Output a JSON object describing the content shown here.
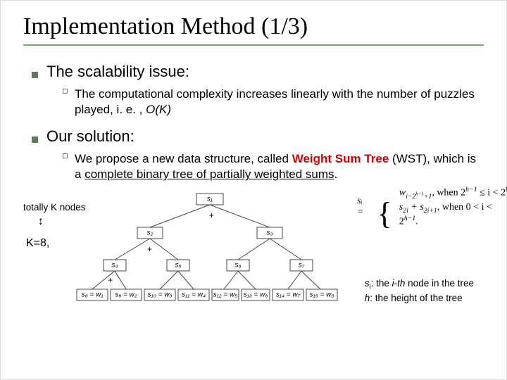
{
  "title": "Implementation Method (1/3)",
  "bullets": {
    "b1": "The scalability issue:",
    "b1_1a": "The computational complexity increases linearly with the number of puzzles played, i. e. , ",
    "b1_1b": "O(K)",
    "b2": "Our solution:",
    "b2_1a": "We propose a new data structure, called ",
    "b2_1b": "Weight Sum Tree",
    "b2_1c": " (WST), which is a ",
    "b2_1d": "complete binary tree of partially weighted sums",
    "b2_1e": "."
  },
  "figure": {
    "totally": "totally K nodes",
    "kline": "K=8,",
    "caption_l1_a": "s",
    "caption_l1_b": "i",
    "caption_l1_c": ": the ",
    "caption_l1_d": "i-th",
    "caption_l1_e": " node in the tree",
    "caption_l2_a": "h",
    "caption_l2_b": ": the height of the tree",
    "nodes": {
      "s1": "s₁",
      "s2": "s₂",
      "s3": "s₃",
      "s4": "s₄",
      "s5": "s₅",
      "s6": "s₆",
      "s7": "s₇",
      "l1": "s₈ = w₁",
      "l2": "s₉ = w₂",
      "l3": "s₁₀ = w₃",
      "l4": "s₁₁ = w₄",
      "l5": "s₁₂ = w₅",
      "l6": "s₁₃ = w₆",
      "l7": "s₁₄ = w₇",
      "l8": "s₁₅ = w₈"
    }
  },
  "formula": {
    "lhs": "sᵢ =",
    "r1a": "w",
    "r1b": "i−2",
    "r1c": "h−1",
    "r1d": "+1",
    "r1cond_a": ", when 2",
    "r1cond_b": "h−1",
    "r1cond_c": " ≤ i < 2",
    "r1cond_d": "h",
    "r1cond_e": ";",
    "r2a": "s",
    "r2b": "2i",
    "r2c": " + s",
    "r2d": "2i+1",
    "r2cond_a": ", when 0 < i < 2",
    "r2cond_b": "h−1",
    "r2cond_c": "."
  }
}
